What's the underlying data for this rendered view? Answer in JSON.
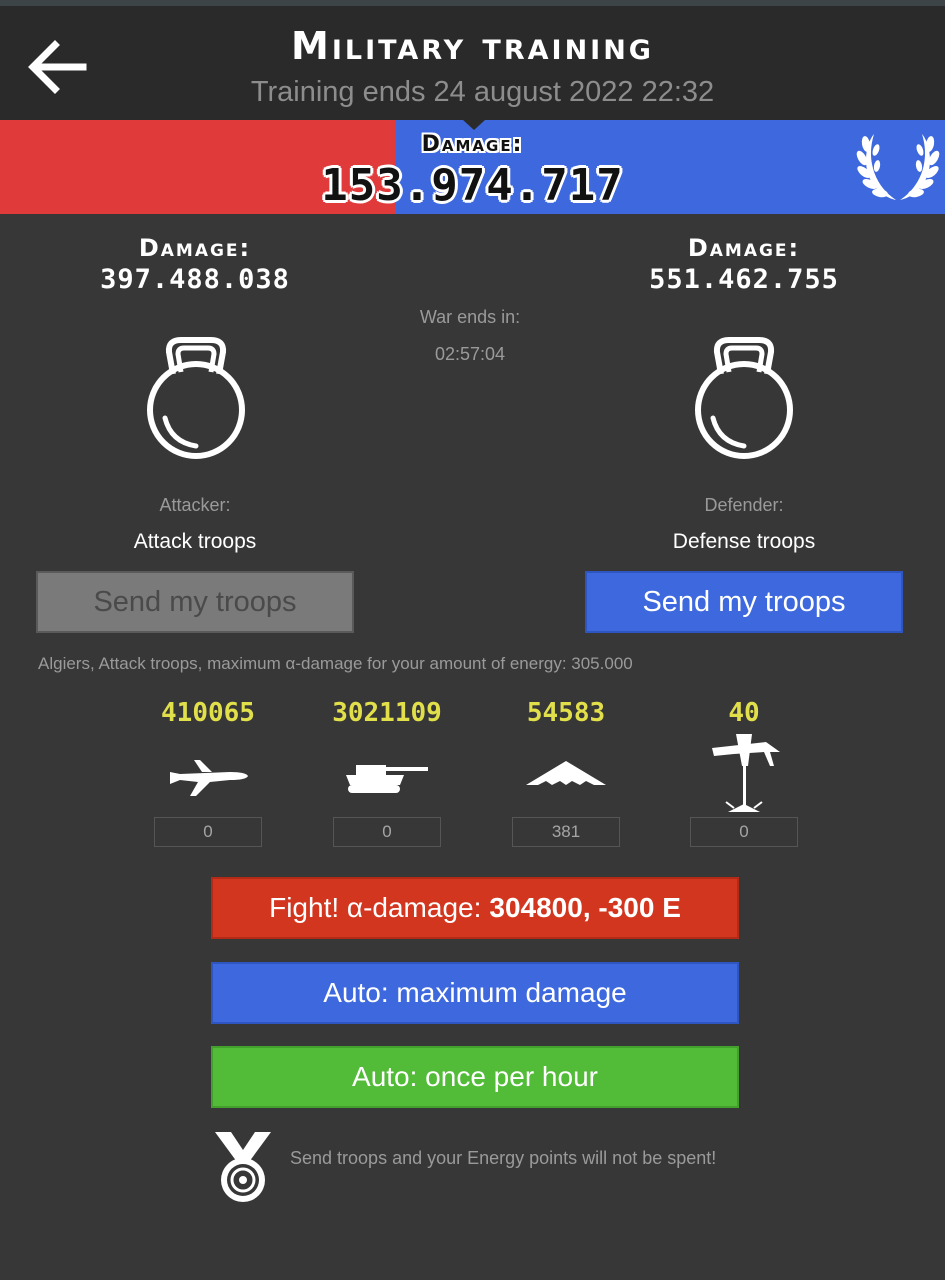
{
  "header": {
    "title": "Military training",
    "subtitle": "Training ends 24 august 2022 22:32"
  },
  "damage_bar": {
    "label": "Damage:",
    "value": "153.974.717",
    "attacker_share": 0.419,
    "colors": {
      "attacker": "#e03a3a",
      "defender": "#3d68de"
    },
    "icon": "laurel-wreath-icon"
  },
  "attacker": {
    "damage_label": "Damage:",
    "damage_value": "397.488.038",
    "role_label": "Attacker:",
    "role_name": "Attack troops",
    "icon": "kettlebell-icon",
    "send_label": "Send my troops"
  },
  "defender": {
    "damage_label": "Damage:",
    "damage_value": "551.462.755",
    "role_label": "Defender:",
    "role_name": "Defense troops",
    "icon": "kettlebell-icon",
    "send_label": "Send my troops"
  },
  "war": {
    "label": "War ends in:",
    "time": "02:57:04"
  },
  "info_line": "Algiers, Attack troops, maximum α-damage for your amount of energy: 305.000",
  "units": [
    {
      "name": "airplane",
      "icon": "airplane-icon",
      "count": "410065",
      "input": "0"
    },
    {
      "name": "tank",
      "icon": "tank-icon",
      "count": "3021109",
      "input": "0"
    },
    {
      "name": "stealth-bomber",
      "icon": "stealth-bomber-icon",
      "count": "54583",
      "input": "381"
    },
    {
      "name": "drone",
      "icon": "drone-icon",
      "count": "40",
      "input": "0"
    }
  ],
  "actions": {
    "fight_prefix": "Fight! α-damage:",
    "fight_value": "304800, -300 E",
    "auto_max": "Auto: maximum damage",
    "auto_hourly": "Auto: once per hour"
  },
  "note": {
    "icon": "medal-icon",
    "text": "Send troops and your Energy points will not be spent!"
  }
}
